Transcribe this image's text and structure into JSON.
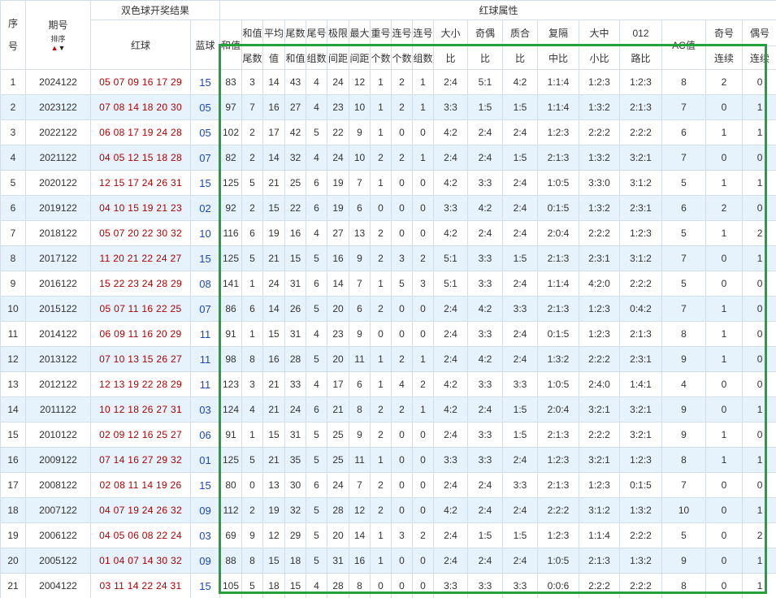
{
  "header": {
    "seq": "序号",
    "period": "期号",
    "sort_label": "排序",
    "draw_group": "双色球开奖结果",
    "attr_group": "红球属性",
    "red_ball": "红球",
    "blue_ball": "蓝球",
    "cols": [
      {
        "top": "和值",
        "bottom": ""
      },
      {
        "top": "和值",
        "bottom": "尾数"
      },
      {
        "top": "平均",
        "bottom": "值"
      },
      {
        "top": "尾数",
        "bottom": "和值"
      },
      {
        "top": "尾号",
        "bottom": "组数"
      },
      {
        "top": "极限",
        "bottom": "间距"
      },
      {
        "top": "最大",
        "bottom": "间距"
      },
      {
        "top": "重号",
        "bottom": "个数"
      },
      {
        "top": "连号",
        "bottom": "个数"
      },
      {
        "top": "连号",
        "bottom": "组数"
      },
      {
        "top": "大小",
        "bottom": "比"
      },
      {
        "top": "奇偶",
        "bottom": "比"
      },
      {
        "top": "质合",
        "bottom": "比"
      },
      {
        "top": "复隔",
        "bottom": "中比"
      },
      {
        "top": "大中",
        "bottom": "小比"
      },
      {
        "top": "012",
        "bottom": "路比"
      },
      {
        "top": "AC值",
        "bottom": ""
      },
      {
        "top": "奇号",
        "bottom": "连续"
      },
      {
        "top": "偶号",
        "bottom": "连续"
      }
    ]
  },
  "rows": [
    {
      "seq": "1",
      "period": "2024122",
      "red": "05 07 09 16 17 29",
      "blue": "15",
      "attrs": [
        "83",
        "3",
        "14",
        "43",
        "4",
        "24",
        "12",
        "1",
        "2",
        "1",
        "2:4",
        "5:1",
        "4:2",
        "1:1:4",
        "1:2:3",
        "1:2:3",
        "8",
        "2",
        "0"
      ]
    },
    {
      "seq": "2",
      "period": "2023122",
      "red": "07 08 14 18 20 30",
      "blue": "05",
      "attrs": [
        "97",
        "7",
        "16",
        "27",
        "4",
        "23",
        "10",
        "1",
        "2",
        "1",
        "3:3",
        "1:5",
        "1:5",
        "1:1:4",
        "1:3:2",
        "2:1:3",
        "7",
        "0",
        "1"
      ]
    },
    {
      "seq": "3",
      "period": "2022122",
      "red": "06 08 17 19 24 28",
      "blue": "05",
      "attrs": [
        "102",
        "2",
        "17",
        "42",
        "5",
        "22",
        "9",
        "1",
        "0",
        "0",
        "4:2",
        "2:4",
        "2:4",
        "1:2:3",
        "2:2:2",
        "2:2:2",
        "6",
        "1",
        "1"
      ]
    },
    {
      "seq": "4",
      "period": "2021122",
      "red": "04 05 12 15 18 28",
      "blue": "07",
      "attrs": [
        "82",
        "2",
        "14",
        "32",
        "4",
        "24",
        "10",
        "2",
        "2",
        "1",
        "2:4",
        "2:4",
        "1:5",
        "2:1:3",
        "1:3:2",
        "3:2:1",
        "7",
        "0",
        "0"
      ]
    },
    {
      "seq": "5",
      "period": "2020122",
      "red": "12 15 17 24 26 31",
      "blue": "15",
      "attrs": [
        "125",
        "5",
        "21",
        "25",
        "6",
        "19",
        "7",
        "1",
        "0",
        "0",
        "4:2",
        "3:3",
        "2:4",
        "1:0:5",
        "3:3:0",
        "3:1:2",
        "5",
        "1",
        "1"
      ]
    },
    {
      "seq": "6",
      "period": "2019122",
      "red": "04 10 15 19 21 23",
      "blue": "02",
      "attrs": [
        "92",
        "2",
        "15",
        "22",
        "6",
        "19",
        "6",
        "0",
        "0",
        "0",
        "3:3",
        "4:2",
        "2:4",
        "0:1:5",
        "1:3:2",
        "2:3:1",
        "6",
        "2",
        "0"
      ]
    },
    {
      "seq": "7",
      "period": "2018122",
      "red": "05 07 20 22 30 32",
      "blue": "10",
      "attrs": [
        "116",
        "6",
        "19",
        "16",
        "4",
        "27",
        "13",
        "2",
        "0",
        "0",
        "4:2",
        "2:4",
        "2:4",
        "2:0:4",
        "2:2:2",
        "1:2:3",
        "5",
        "1",
        "2"
      ]
    },
    {
      "seq": "8",
      "period": "2017122",
      "red": "11 20 21 22 24 27",
      "blue": "15",
      "attrs": [
        "125",
        "5",
        "21",
        "15",
        "5",
        "16",
        "9",
        "2",
        "3",
        "2",
        "5:1",
        "3:3",
        "1:5",
        "2:1:3",
        "2:3:1",
        "3:1:2",
        "7",
        "0",
        "1"
      ]
    },
    {
      "seq": "9",
      "period": "2016122",
      "red": "15 22 23 24 28 29",
      "blue": "08",
      "attrs": [
        "141",
        "1",
        "24",
        "31",
        "6",
        "14",
        "7",
        "1",
        "5",
        "3",
        "5:1",
        "3:3",
        "2:4",
        "1:1:4",
        "4:2:0",
        "2:2:2",
        "5",
        "0",
        "0"
      ]
    },
    {
      "seq": "10",
      "period": "2015122",
      "red": "05 07 11 16 22 25",
      "blue": "07",
      "attrs": [
        "86",
        "6",
        "14",
        "26",
        "5",
        "20",
        "6",
        "2",
        "0",
        "0",
        "2:4",
        "4:2",
        "3:3",
        "2:1:3",
        "1:2:3",
        "0:4:2",
        "7",
        "1",
        "0"
      ]
    },
    {
      "seq": "11",
      "period": "2014122",
      "red": "06 09 11 16 20 29",
      "blue": "11",
      "attrs": [
        "91",
        "1",
        "15",
        "31",
        "4",
        "23",
        "9",
        "0",
        "0",
        "0",
        "2:4",
        "3:3",
        "2:4",
        "0:1:5",
        "1:2:3",
        "2:1:3",
        "8",
        "1",
        "0"
      ]
    },
    {
      "seq": "12",
      "period": "2013122",
      "red": "07 10 13 15 26 27",
      "blue": "11",
      "attrs": [
        "98",
        "8",
        "16",
        "28",
        "5",
        "20",
        "11",
        "1",
        "2",
        "1",
        "2:4",
        "4:2",
        "2:4",
        "1:3:2",
        "2:2:2",
        "2:3:1",
        "9",
        "1",
        "0"
      ]
    },
    {
      "seq": "13",
      "period": "2012122",
      "red": "12 13 19 22 28 29",
      "blue": "11",
      "attrs": [
        "123",
        "3",
        "21",
        "33",
        "4",
        "17",
        "6",
        "1",
        "4",
        "2",
        "4:2",
        "3:3",
        "3:3",
        "1:0:5",
        "2:4:0",
        "1:4:1",
        "4",
        "0",
        "0"
      ]
    },
    {
      "seq": "14",
      "period": "2011122",
      "red": "10 12 18 26 27 31",
      "blue": "03",
      "attrs": [
        "124",
        "4",
        "21",
        "24",
        "6",
        "21",
        "8",
        "2",
        "2",
        "1",
        "4:2",
        "2:4",
        "1:5",
        "2:0:4",
        "3:2:1",
        "3:2:1",
        "9",
        "0",
        "1"
      ]
    },
    {
      "seq": "15",
      "period": "2010122",
      "red": "02 09 12 16 25 27",
      "blue": "06",
      "attrs": [
        "91",
        "1",
        "15",
        "31",
        "5",
        "25",
        "9",
        "2",
        "0",
        "0",
        "2:4",
        "3:3",
        "1:5",
        "2:1:3",
        "2:2:2",
        "3:2:1",
        "9",
        "1",
        "0"
      ]
    },
    {
      "seq": "16",
      "period": "2009122",
      "red": "07 14 16 27 29 32",
      "blue": "01",
      "attrs": [
        "125",
        "5",
        "21",
        "35",
        "5",
        "25",
        "11",
        "1",
        "0",
        "0",
        "3:3",
        "3:3",
        "2:4",
        "1:2:3",
        "3:2:1",
        "1:2:3",
        "8",
        "1",
        "1"
      ]
    },
    {
      "seq": "17",
      "period": "2008122",
      "red": "02 08 11 14 19 26",
      "blue": "15",
      "attrs": [
        "80",
        "0",
        "13",
        "30",
        "6",
        "24",
        "7",
        "2",
        "0",
        "0",
        "2:4",
        "2:4",
        "3:3",
        "2:1:3",
        "1:2:3",
        "0:1:5",
        "7",
        "0",
        "0"
      ]
    },
    {
      "seq": "18",
      "period": "2007122",
      "red": "04 07 19 24 26 32",
      "blue": "09",
      "attrs": [
        "112",
        "2",
        "19",
        "32",
        "5",
        "28",
        "12",
        "2",
        "0",
        "0",
        "4:2",
        "2:4",
        "2:4",
        "2:2:2",
        "3:1:2",
        "1:3:2",
        "10",
        "0",
        "1"
      ]
    },
    {
      "seq": "19",
      "period": "2006122",
      "red": "04 05 06 08 22 24",
      "blue": "03",
      "attrs": [
        "69",
        "9",
        "12",
        "29",
        "5",
        "20",
        "14",
        "1",
        "3",
        "2",
        "2:4",
        "1:5",
        "1:5",
        "1:2:3",
        "1:1:4",
        "2:2:2",
        "5",
        "0",
        "2"
      ]
    },
    {
      "seq": "20",
      "period": "2005122",
      "red": "01 04 07 14 30 32",
      "blue": "09",
      "attrs": [
        "88",
        "8",
        "15",
        "18",
        "5",
        "31",
        "16",
        "1",
        "0",
        "0",
        "2:4",
        "2:4",
        "2:4",
        "1:0:5",
        "2:1:3",
        "1:3:2",
        "9",
        "0",
        "1"
      ]
    },
    {
      "seq": "21",
      "period": "2004122",
      "red": "03 11 14 22 24 31",
      "blue": "15",
      "attrs": [
        "105",
        "5",
        "18",
        "15",
        "4",
        "28",
        "8",
        "0",
        "0",
        "0",
        "3:3",
        "3:3",
        "3:3",
        "0:0:6",
        "2:2:2",
        "2:2:2",
        "8",
        "0",
        "1"
      ]
    }
  ],
  "colors": {
    "red_ball": "#b00000",
    "blue_ball": "#1a47c8",
    "highlight": "#22a33a",
    "row_alt": "#e6f2fc",
    "border": "#d4dde8"
  }
}
